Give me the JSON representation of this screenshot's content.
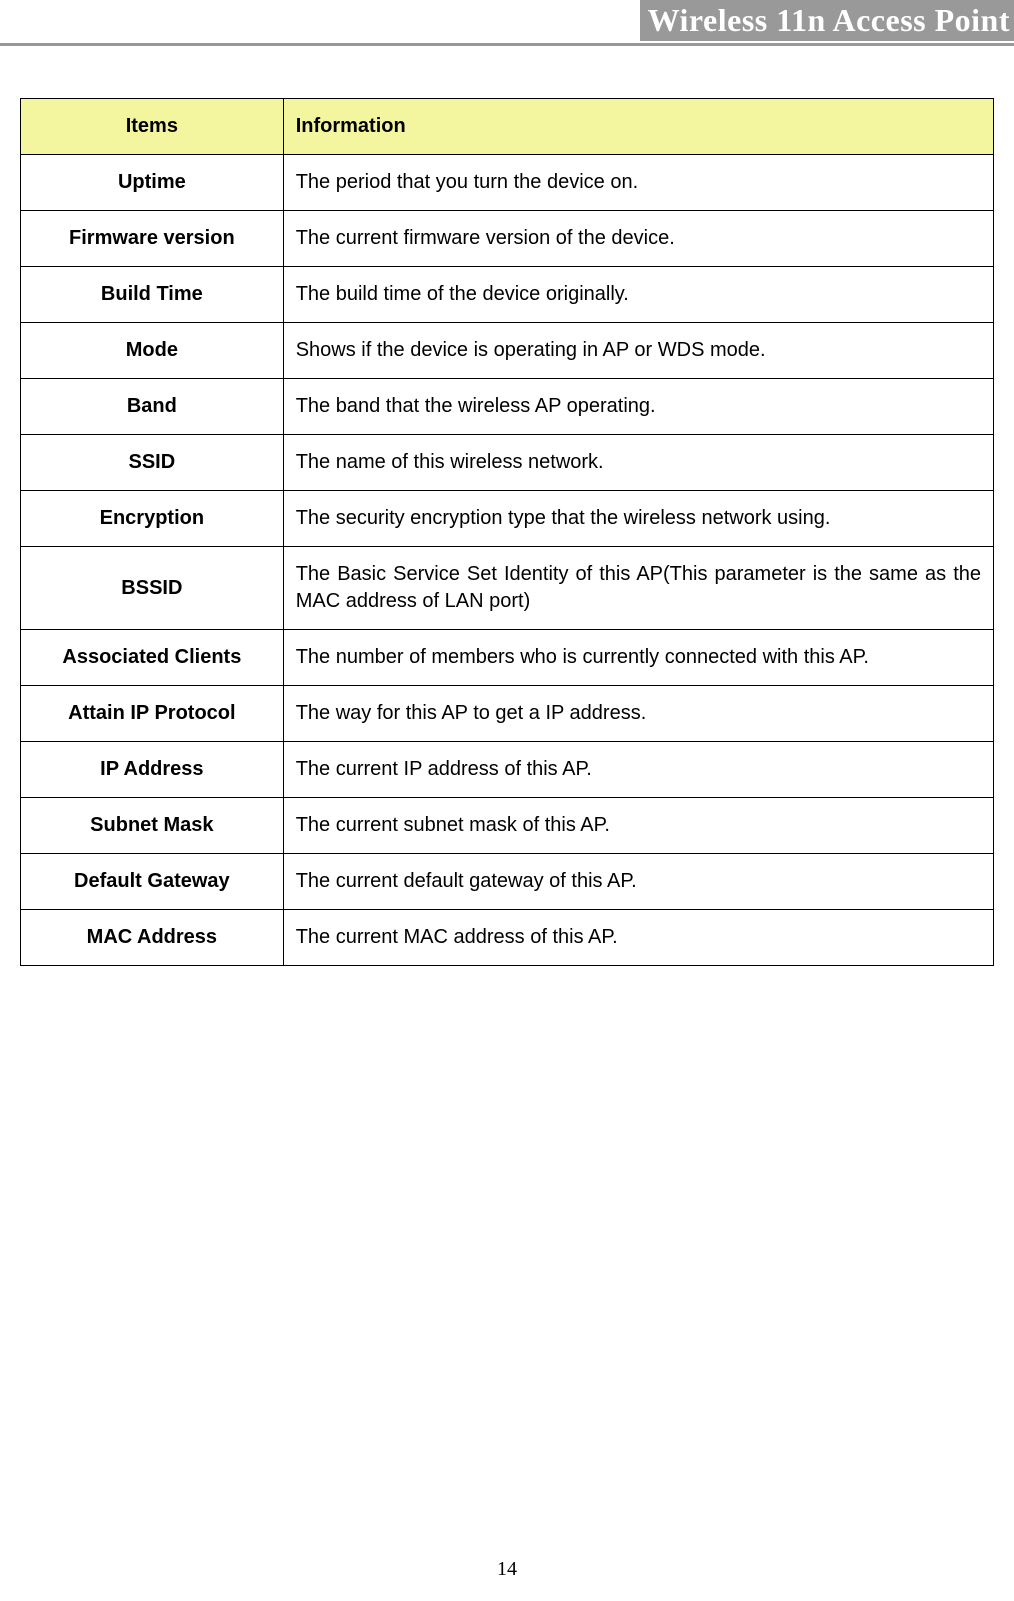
{
  "header": {
    "title": "Wireless 11n Access Point"
  },
  "table": {
    "headers": {
      "items": "Items",
      "information": "Information"
    },
    "rows": [
      {
        "item": "Uptime",
        "info": "The period that you turn the device on.",
        "justify": false
      },
      {
        "item": "Firmware version",
        "info": "The current firmware version of the device.",
        "justify": false
      },
      {
        "item": "Build Time",
        "info": "The build time of the device originally.",
        "justify": false
      },
      {
        "item": "Mode",
        "info": "Shows if the device is operating in AP or WDS mode.",
        "justify": false
      },
      {
        "item": "Band",
        "info": "The band that the wireless AP operating.",
        "justify": false
      },
      {
        "item": "SSID",
        "info": "The name of this wireless network.",
        "justify": false
      },
      {
        "item": "Encryption",
        "info": "The security encryption type that the wireless network using.",
        "justify": false
      },
      {
        "item": "BSSID",
        "info": "The Basic Service Set Identity of this AP(This parameter is the same as the MAC address of LAN port)",
        "justify": true
      },
      {
        "item": "Associated Clients",
        "info": "The number of members who is currently connected with this AP.",
        "justify": false
      },
      {
        "item": "Attain IP Protocol",
        "info": "The way for this AP to get a IP address.",
        "justify": false
      },
      {
        "item": "IP Address",
        "info": "The current IP address of this AP.",
        "justify": false
      },
      {
        "item": "Subnet Mask",
        "info": "The current subnet mask of this AP.",
        "justify": false
      },
      {
        "item": "Default Gateway",
        "info": "The current default gateway of this AP.",
        "justify": false
      },
      {
        "item": "MAC Address",
        "info": "The current MAC address of this AP.",
        "justify": false
      }
    ]
  },
  "footer": {
    "page_number": "14"
  }
}
